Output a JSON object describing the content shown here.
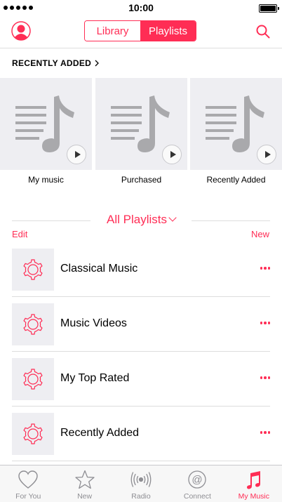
{
  "status": {
    "time": "10:00"
  },
  "nav": {
    "segments": [
      "Library",
      "Playlists"
    ],
    "selected_segment": "Playlists"
  },
  "recently_added": {
    "header": "RECENTLY ADDED",
    "items": [
      {
        "label": "My music"
      },
      {
        "label": "Purchased"
      },
      {
        "label": "Recently Added"
      }
    ]
  },
  "playlists": {
    "title": "All Playlists",
    "edit_label": "Edit",
    "new_label": "New",
    "items": [
      {
        "name": "Classical Music"
      },
      {
        "name": "Music Videos"
      },
      {
        "name": "My Top Rated"
      },
      {
        "name": "Recently Added"
      }
    ]
  },
  "tabbar": {
    "tabs": [
      {
        "label": "For You",
        "icon": "heart-icon"
      },
      {
        "label": "New",
        "icon": "star-icon"
      },
      {
        "label": "Radio",
        "icon": "radio-icon"
      },
      {
        "label": "Connect",
        "icon": "at-icon"
      },
      {
        "label": "My Music",
        "icon": "music-note-icon"
      }
    ],
    "active_tab": "My Music"
  },
  "colors": {
    "accent": "#ff2d55",
    "tile_bg": "#eeeef2",
    "icon_gray": "#a9a9ac",
    "tab_gray": "#8e8e93"
  }
}
